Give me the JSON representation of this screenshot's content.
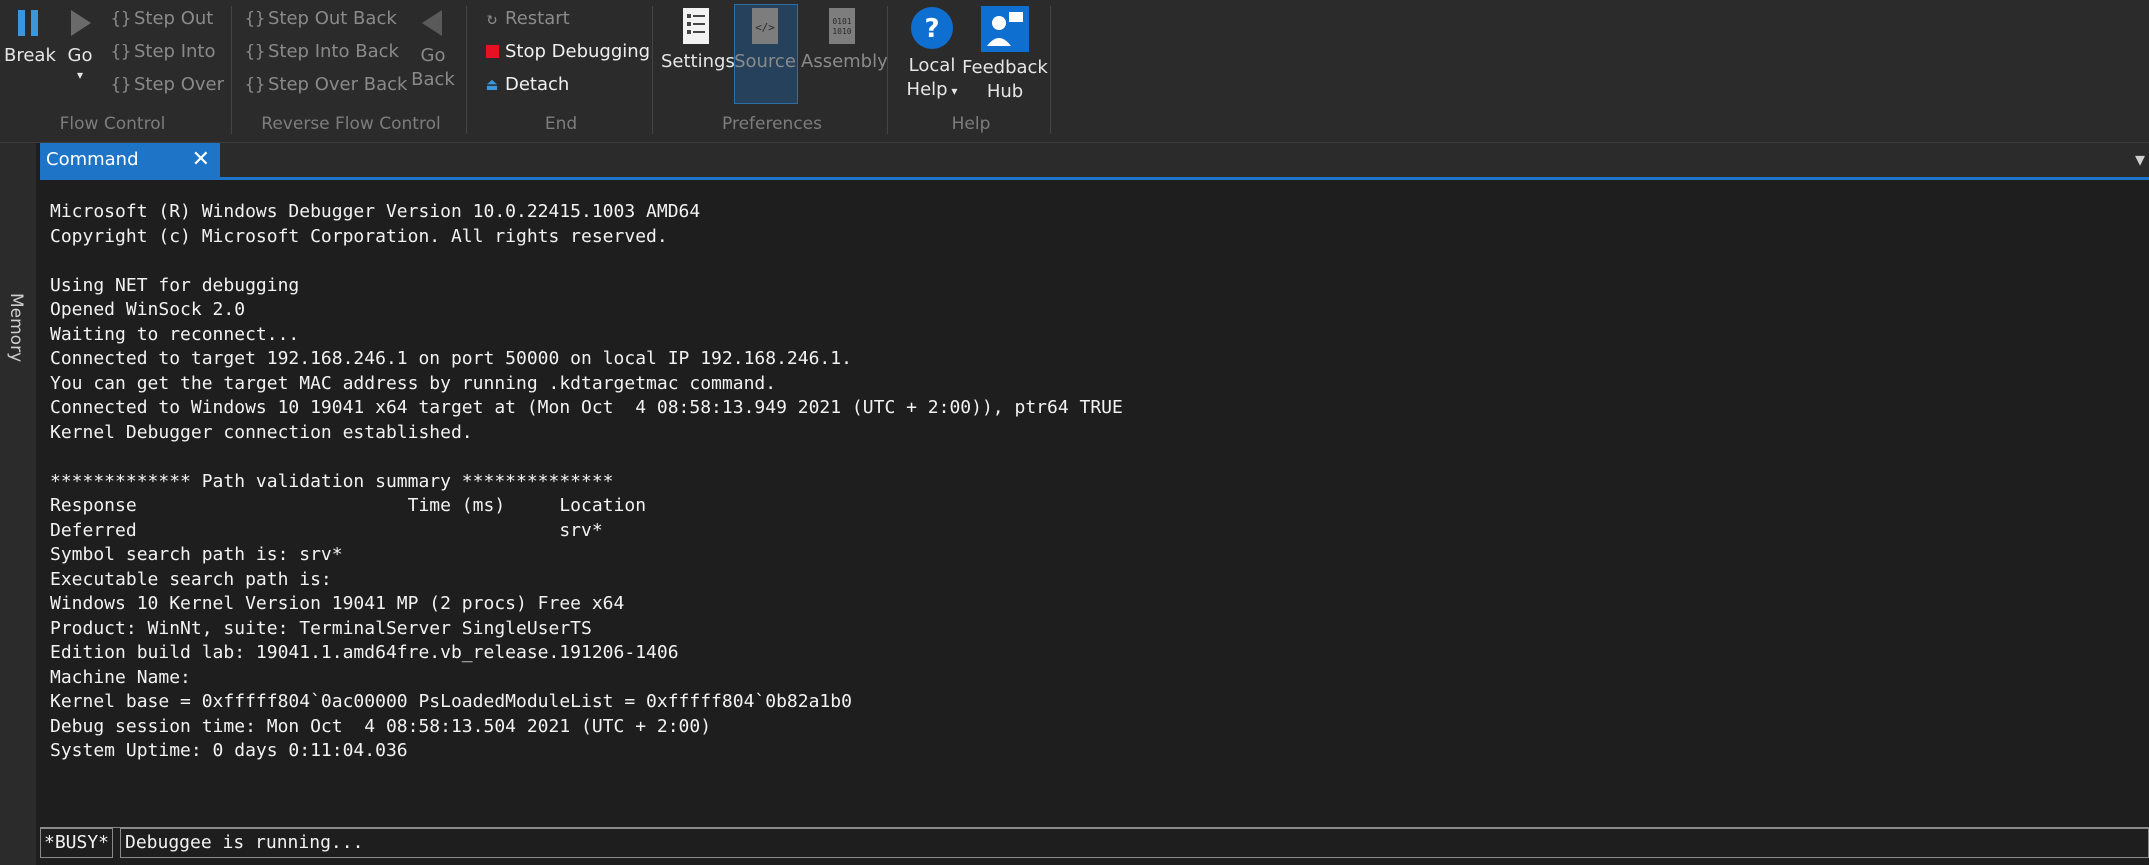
{
  "ribbon": {
    "flow_control": {
      "label": "Flow Control",
      "break_label": "Break",
      "go_label": "Go",
      "step_out": "Step Out",
      "step_into": "Step Into",
      "step_over": "Step Over"
    },
    "reverse_flow": {
      "label": "Reverse Flow Control",
      "step_out_back": "Step Out Back",
      "step_into_back": "Step Into Back",
      "step_over_back": "Step Over Back",
      "go_back_line1": "Go",
      "go_back_line2": "Back"
    },
    "end": {
      "label": "End",
      "restart": "Restart",
      "stop": "Stop Debugging",
      "detach": "Detach"
    },
    "preferences": {
      "label": "Preferences",
      "settings": "Settings",
      "source": "Source",
      "assembly": "Assembly"
    },
    "help": {
      "label": "Help",
      "local_help_line1": "Local",
      "local_help_line2": "Help",
      "feedback_line1": "Feedback",
      "feedback_line2": "Hub"
    }
  },
  "side_tab": "Memory",
  "tab": {
    "label": "Command"
  },
  "output_lines": [
    "Microsoft (R) Windows Debugger Version 10.0.22415.1003 AMD64",
    "Copyright (c) Microsoft Corporation. All rights reserved.",
    "",
    "Using NET for debugging",
    "Opened WinSock 2.0",
    "Waiting to reconnect...",
    "Connected to target 192.168.246.1 on port 50000 on local IP 192.168.246.1.",
    "You can get the target MAC address by running .kdtargetmac command.",
    "Connected to Windows 10 19041 x64 target at (Mon Oct  4 08:58:13.949 2021 (UTC + 2:00)), ptr64 TRUE",
    "Kernel Debugger connection established.",
    "",
    "************* Path validation summary **************",
    "Response                         Time (ms)     Location",
    "Deferred                                       srv*",
    "Symbol search path is: srv*",
    "Executable search path is: ",
    "Windows 10 Kernel Version 19041 MP (2 procs) Free x64",
    "Product: WinNt, suite: TerminalServer SingleUserTS",
    "Edition build lab: 19041.1.amd64fre.vb_release.191206-1406",
    "Machine Name:",
    "Kernel base = 0xfffff804`0ac00000 PsLoadedModuleList = 0xfffff804`0b82a1b0",
    "Debug session time: Mon Oct  4 08:58:13.504 2021 (UTC + 2:00)",
    "System Uptime: 0 days 0:11:04.036"
  ],
  "status": {
    "busy": "*BUSY*",
    "message": "Debuggee is running..."
  },
  "colors": {
    "accent": "#1e74c6",
    "stop": "#e81123",
    "detach": "#3a96dd"
  }
}
